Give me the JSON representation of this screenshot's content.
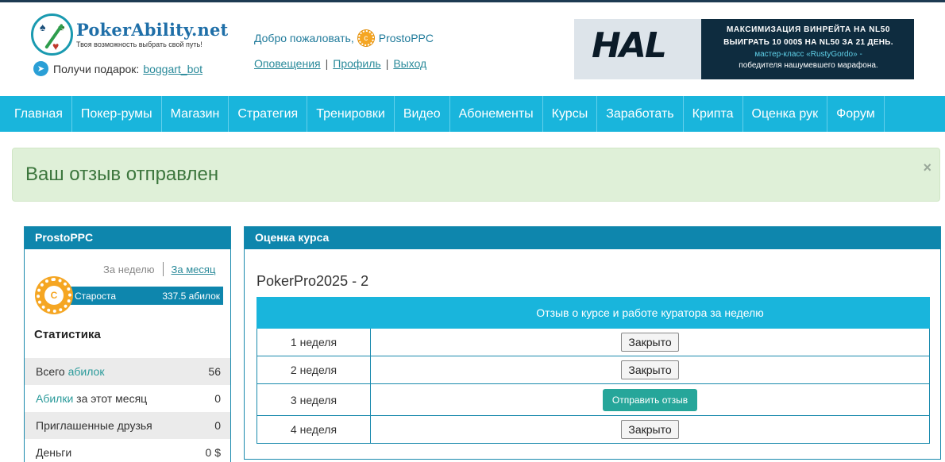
{
  "header": {
    "logo_title": "PokerAbility.net",
    "logo_tagline": "Твоя возможность выбрать свой путь!",
    "gift_label": "Получи подарок:",
    "gift_link": "boggart_bot",
    "welcome_text": "Добро пожаловать,",
    "username": "ProstoPPC",
    "user_links": [
      "Оповещения",
      "Профиль",
      "Выход"
    ],
    "banner": {
      "logo_text": "HAL",
      "line1": "МАКСИМИЗАЦИЯ ВИНРЕЙТА НА NL50",
      "line2": "ВЫИГРАТЬ 10 000$ НА NL50 ЗА 21 ДЕНЬ.",
      "line3": "мастер-класс «RustyGordo» -",
      "line4": "победителя нашумевшего марафона."
    }
  },
  "nav": [
    "Главная",
    "Покер-румы",
    "Магазин",
    "Стратегия",
    "Тренировки",
    "Видео",
    "Абонементы",
    "Курсы",
    "Заработать",
    "Крипта",
    "Оценка рук",
    "Форум"
  ],
  "alert": {
    "text": "Ваш отзыв отправлен",
    "close": "×"
  },
  "sidebar": {
    "title": "ProstoPPC",
    "period_week": "За неделю",
    "period_month": "За месяц",
    "chip_letter": "C",
    "rank_name": "Староста",
    "rank_value": "337.5 абилок",
    "stats_title": "Статистика",
    "stats": [
      {
        "pre": "Всего ",
        "link": "абилок",
        "post": "",
        "value": "56"
      },
      {
        "pre": "",
        "link": "Абилки",
        "post": " за этот месяц",
        "value": "0"
      },
      {
        "pre": "Приглашенные друзья",
        "link": "",
        "post": "",
        "value": "0"
      },
      {
        "pre": "Деньги",
        "link": "",
        "post": "",
        "value": "0 $"
      }
    ]
  },
  "main": {
    "panel_title": "Оценка курса",
    "course_name": "PokerPro2025 - 2",
    "table_header": "Отзыв о курсе и работе куратора за неделю",
    "rows": [
      {
        "week": "1 неделя",
        "action": "Закрыто",
        "type": "closed"
      },
      {
        "week": "2 неделя",
        "action": "Закрыто",
        "type": "closed"
      },
      {
        "week": "3 неделя",
        "action": "Отправить отзыв",
        "type": "send"
      },
      {
        "week": "4 неделя",
        "action": "Закрыто",
        "type": "closed"
      }
    ]
  },
  "colors": {
    "nav": "#19b5dc",
    "panel_head": "#0e86ad",
    "alert_bg": "#dff0d8",
    "send_button": "#26a69a"
  }
}
